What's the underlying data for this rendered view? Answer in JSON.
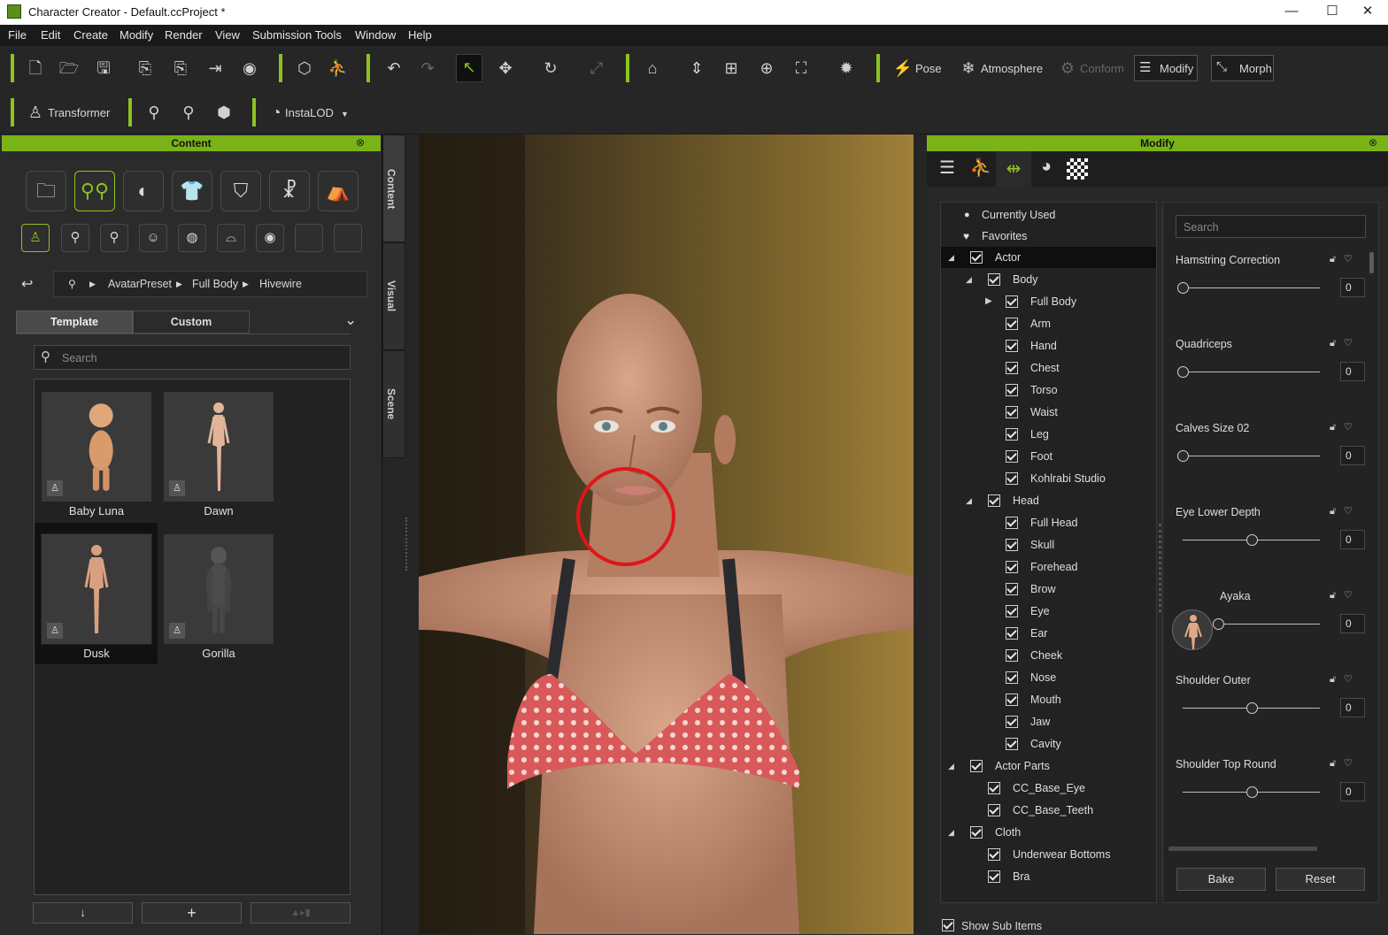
{
  "window": {
    "title": "Character Creator - Default.ccProject *",
    "minimize": "—",
    "maximize": "☐",
    "close": "✕"
  },
  "menu": [
    "File",
    "Edit",
    "Create",
    "Modify",
    "Render",
    "View",
    "Submission Tools",
    "Window",
    "Help"
  ],
  "toolbar": {
    "pose": "Pose",
    "atmosphere": "Atmosphere",
    "conform": "Conform",
    "modify": "Modify",
    "morph": "Morph",
    "transformer": "Transformer",
    "instalod": "InstaLOD"
  },
  "content": {
    "title": "Content",
    "tabs": [
      "Content",
      "Visual",
      "Scene"
    ],
    "breadcrumb": [
      "AvatarPreset",
      "Full Body",
      "Hivewire"
    ],
    "subtabs": {
      "template": "Template",
      "custom": "Custom"
    },
    "search_placeholder": "Search",
    "items": [
      {
        "name": "Baby Luna"
      },
      {
        "name": "Dawn"
      },
      {
        "name": "Dusk",
        "selected": true
      },
      {
        "name": "Gorilla"
      }
    ],
    "bottom_buttons": [
      "↓",
      "+",
      "▲▸▮"
    ]
  },
  "modify": {
    "title": "Modify",
    "tree": {
      "currently_used": "Currently Used",
      "favorites": "Favorites",
      "actor": "Actor",
      "body": "Body",
      "body_items": [
        "Full Body",
        "Arm",
        "Hand",
        "Chest",
        "Torso",
        "Waist",
        "Leg",
        "Foot",
        "Kohlrabi Studio"
      ],
      "head": "Head",
      "head_items": [
        "Full Head",
        "Skull",
        "Forehead",
        "Brow",
        "Eye",
        "Ear",
        "Cheek",
        "Nose",
        "Mouth",
        "Jaw",
        "Cavity"
      ],
      "actor_parts": "Actor Parts",
      "actor_parts_items": [
        "CC_Base_Eye",
        "CC_Base_Teeth"
      ],
      "cloth": "Cloth",
      "cloth_items": [
        "Underwear Bottoms",
        "Bra"
      ]
    },
    "search_placeholder": "Search",
    "sliders": [
      {
        "label": "Hamstring Correction",
        "value": "0",
        "pos": 0.0
      },
      {
        "label": "Quadriceps",
        "value": "0",
        "pos": 0.0
      },
      {
        "label": "Calves Size 02",
        "value": "0",
        "pos": 0.0
      },
      {
        "label": "Eye Lower Depth",
        "value": "0",
        "pos": 0.5
      },
      {
        "label": "Ayaka",
        "value": "0",
        "pos": 0.0
      },
      {
        "label": "Shoulder Outer",
        "value": "0",
        "pos": 0.5
      },
      {
        "label": "Shoulder Top Round",
        "value": "0",
        "pos": 0.5
      }
    ],
    "bake": "Bake",
    "reset": "Reset",
    "show_sub_items": "Show Sub Items"
  }
}
